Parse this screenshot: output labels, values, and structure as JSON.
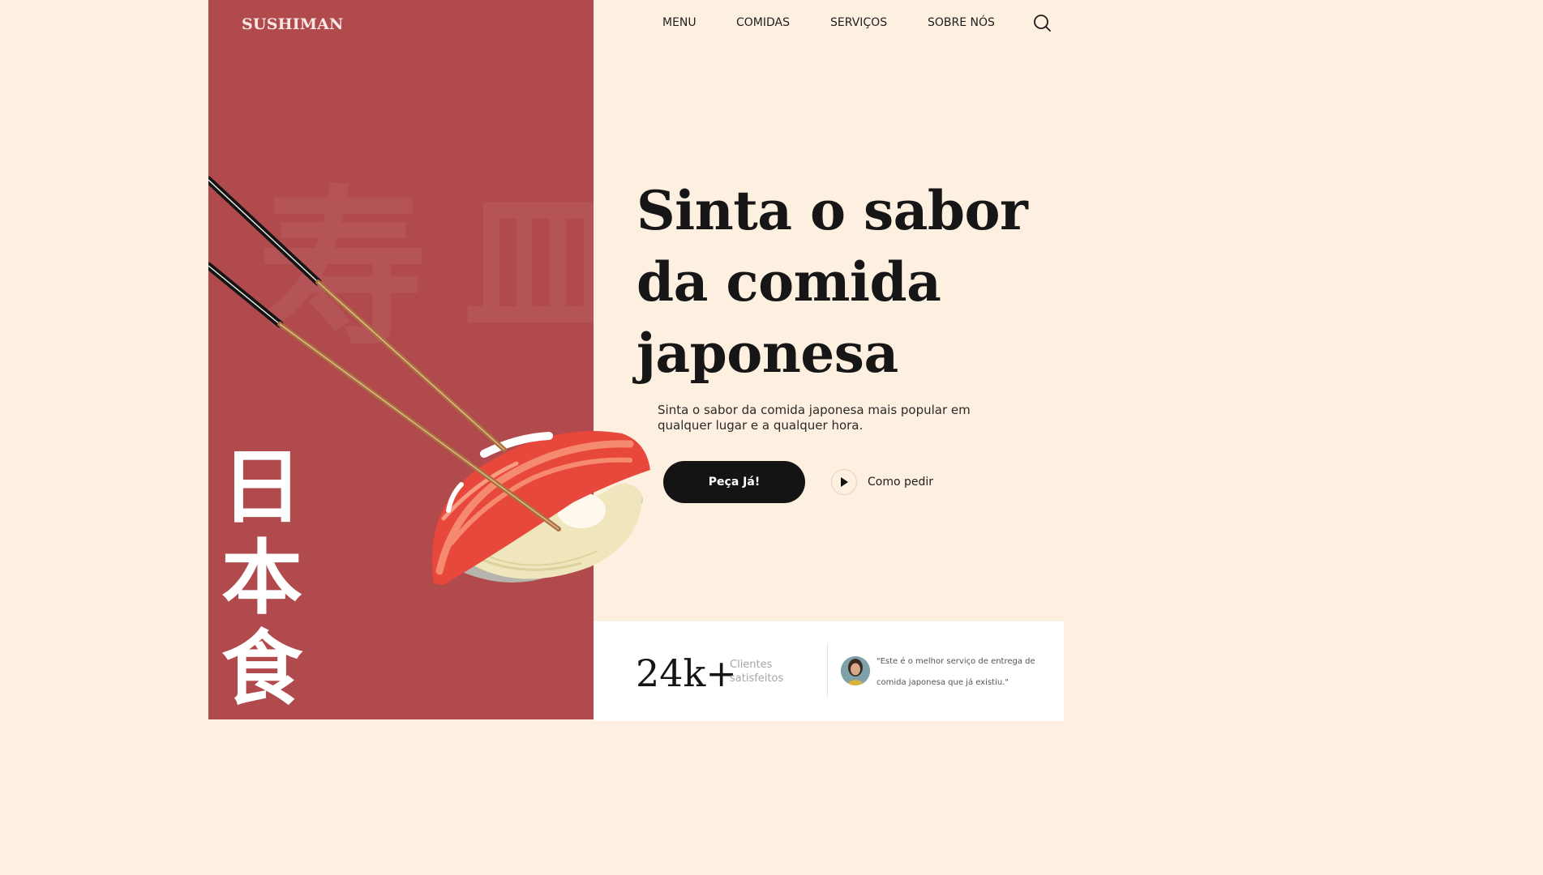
{
  "brand": {
    "logo": "SUSHIMAN",
    "accent": "#b04a4d",
    "background": "#fdf0e0"
  },
  "nav": {
    "items": [
      {
        "label": "MENU"
      },
      {
        "label": "COMIDAS"
      },
      {
        "label": "SERVIÇOS"
      },
      {
        "label": "SOBRE NÓS"
      }
    ],
    "search_icon": "search-icon"
  },
  "decor": {
    "background_kanji": [
      "寿",
      "皿"
    ],
    "vertical_kanji": [
      "日",
      "本",
      "食"
    ]
  },
  "hero": {
    "title_lines": [
      "Sinta o sabor",
      "da comida",
      "japonesa"
    ],
    "description": "Sinta o sabor da comida japonesa mais popular em qualquer lugar e a qualquer hora.",
    "cta_label": "Peça Já!",
    "secondary_label": "Como pedir",
    "secondary_icon": "play-icon"
  },
  "stats": {
    "number": "24k+",
    "label": "Clientes satisfeitos",
    "testimonial": "\"Este é o melhor serviço de entrega de comida japonesa que já existiu.\""
  }
}
